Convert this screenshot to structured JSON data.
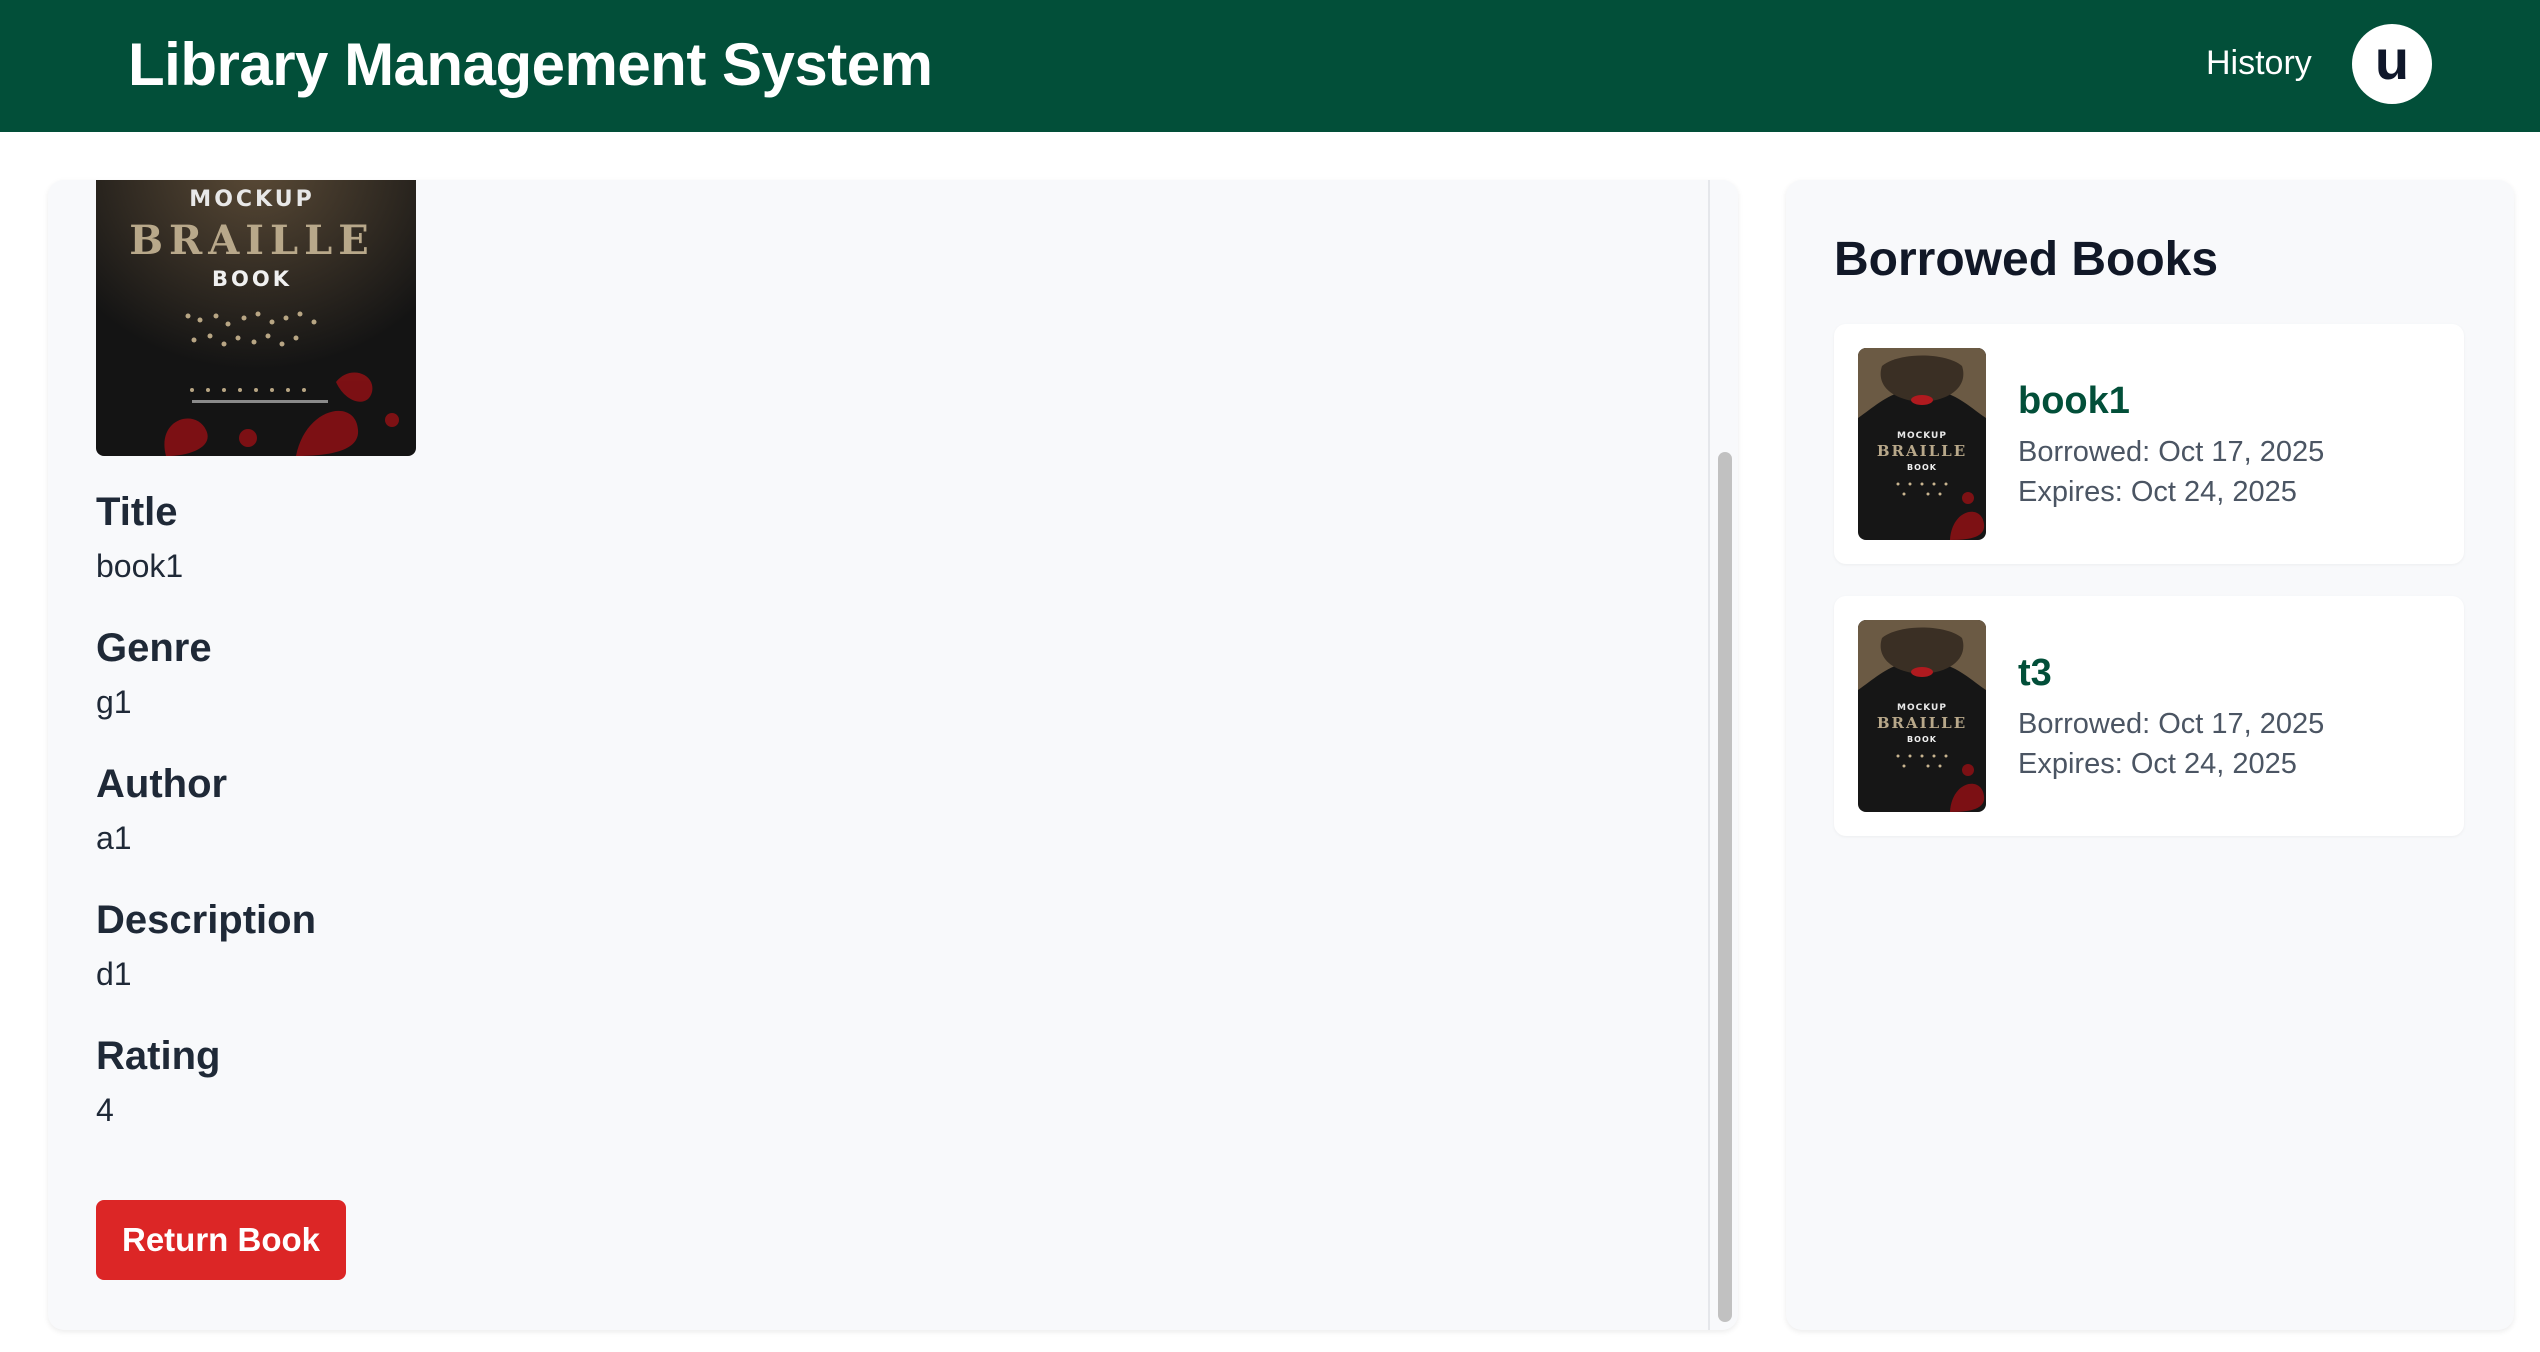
{
  "header": {
    "title": "Library Management System",
    "nav_history": "History",
    "avatar_initial": "u",
    "background_color": "#024f39"
  },
  "book_detail": {
    "cover": {
      "line1": "MOCKUP",
      "line2": "BRAILLE",
      "line3": "BOOK"
    },
    "fields": [
      {
        "label": "Title",
        "value": "book1"
      },
      {
        "label": "Genre",
        "value": "g1"
      },
      {
        "label": "Author",
        "value": "a1"
      },
      {
        "label": "Description",
        "value": "d1"
      },
      {
        "label": "Rating",
        "value": "4"
      }
    ],
    "return_button": "Return Book",
    "return_button_color": "#dc2626"
  },
  "borrowed": {
    "heading": "Borrowed Books",
    "items": [
      {
        "title": "book1",
        "borrowed": "Borrowed: Oct 17, 2025",
        "expires": "Expires: Oct 24, 2025",
        "cover": {
          "line1": "MOCKUP",
          "line2": "BRAILLE",
          "line3": "BOOK"
        }
      },
      {
        "title": "t3",
        "borrowed": "Borrowed: Oct 17, 2025",
        "expires": "Expires: Oct 24, 2025",
        "cover": {
          "line1": "MOCKUP",
          "line2": "BRAILLE",
          "line3": "BOOK"
        }
      }
    ]
  }
}
